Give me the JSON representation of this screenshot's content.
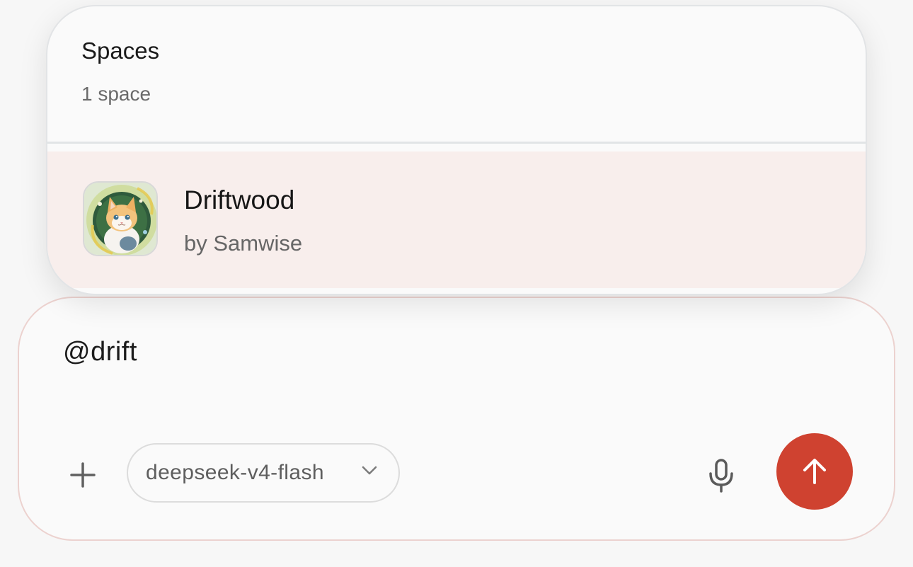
{
  "popup": {
    "title": "Spaces",
    "count": "1 space",
    "items": [
      {
        "name": "Driftwood",
        "owner": "by Samwise",
        "avatar": "kitten-avatar"
      }
    ]
  },
  "composer": {
    "input_value": "@drift",
    "model": "deepseek-v4-flash",
    "icons": {
      "add": "plus-icon",
      "dropdown": "chevron-down-icon",
      "mic": "microphone-icon",
      "send": "arrow-up-icon"
    }
  },
  "colors": {
    "accent": "#cf4230",
    "highlight_row": "#f8eeec"
  }
}
